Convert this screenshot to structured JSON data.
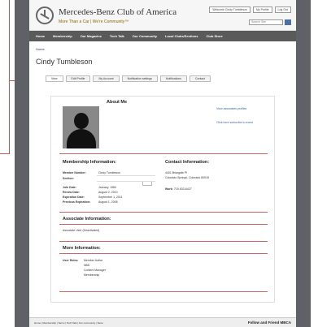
{
  "header": {
    "brand": "Mercedes-Benz Club of America",
    "tagline": "More Than a Car | We're Community™",
    "top_links": [
      "Welcome Cindy Tumbleson",
      "My Profile",
      "Log Out"
    ],
    "search_placeholder": "Search Site"
  },
  "nav": [
    "Home",
    "Membership",
    "Our Magazine",
    "Tech Talk",
    "Our Community",
    "Local Clubs/Sections",
    "Club Store"
  ],
  "breadcrumb": "Home",
  "page_title": "Cindy Tumbleson",
  "tabs": [
    "View",
    "Edit Profile",
    "My Account",
    "Notification settings",
    "Notifications",
    "Contact"
  ],
  "profile": {
    "about_heading": "About Me",
    "side_links": [
      "View associates profiles",
      "Click here subscribe to event"
    ]
  },
  "membership": {
    "heading": "Membership Information:",
    "fields": [
      {
        "k": "Member Number:",
        "v": "Cindy Tumbleson"
      },
      {
        "k": "Section:",
        "v": ""
      },
      {
        "k": "Join Date:",
        "v": "January, 1984"
      },
      {
        "k": "Renew Date:",
        "v": "August 2, 2010"
      },
      {
        "k": "Expiration Date:",
        "v": "September 1, 2011"
      },
      {
        "k": "Previous Expiration:",
        "v": "August 1, 2008"
      }
    ]
  },
  "contact": {
    "heading": "Contact Information:",
    "address1": "4401 Briargate Pl",
    "address2": "Colorado Springs, Colorado 80918",
    "work_label": "Work:",
    "work_value": "719-633-6427"
  },
  "associate": {
    "heading": "Associate Information:",
    "text": "Associate User (Deactivated)"
  },
  "more": {
    "heading": "More Information:",
    "roles_label": "User Roles:",
    "roles": [
      "Member Active",
      "NBD",
      "Content Manager",
      "Membership"
    ]
  },
  "footer": {
    "links": "Home | Membership | Terms | Tech Talk | Our community | Store",
    "friend": "Follow and Friend MBCA"
  }
}
